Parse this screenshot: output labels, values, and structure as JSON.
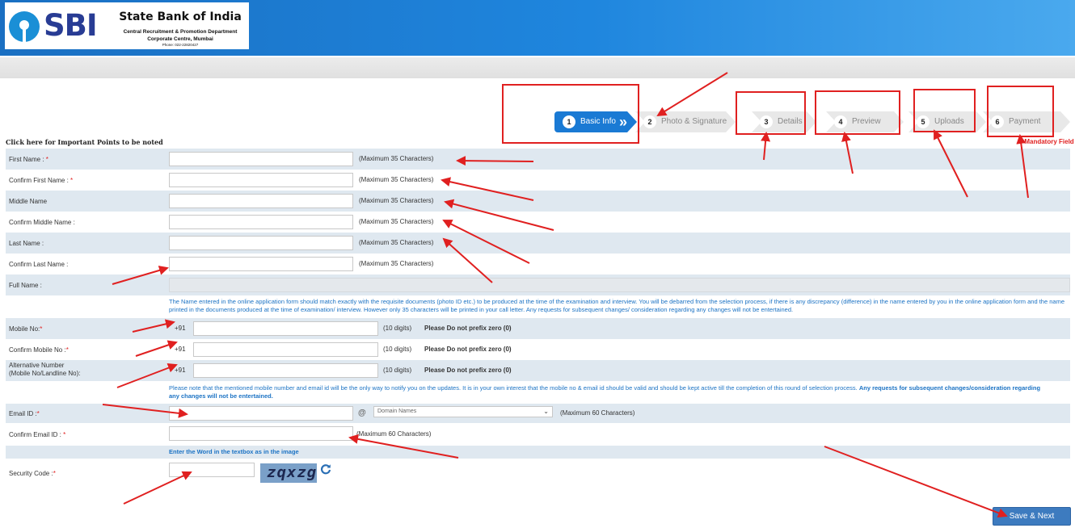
{
  "header": {
    "logo_text": "SBI",
    "bank_name": "State Bank of India",
    "subtitle1": "Central Recruitment & Promotion Department",
    "subtitle2": "Corporate Centre, Mumbai",
    "subtitle3": "Phone: 022-22820427",
    "brand_color": "#1f86de"
  },
  "steps": [
    {
      "num": "1",
      "label": "Basic Info",
      "active": true
    },
    {
      "num": "2",
      "label": "Photo & Signature"
    },
    {
      "num": "3",
      "label": "Details"
    },
    {
      "num": "4",
      "label": "Preview"
    },
    {
      "num": "5",
      "label": "Uploads"
    },
    {
      "num": "6",
      "label": "Payment"
    }
  ],
  "important_link": "Click here for Important Points to be noted",
  "mandatory_note": "* Mandatory Field",
  "form": {
    "first_name": {
      "label": "First Name :",
      "hint": "(Maximum 35 Characters)"
    },
    "confirm_first_name": {
      "label": "Confirm First Name :",
      "hint": "(Maximum 35 Characters)"
    },
    "middle_name": {
      "label": "Middle Name",
      "hint": "(Maximum 35 Characters)"
    },
    "confirm_middle_name": {
      "label": "Confirm Middle Name :",
      "hint": "(Maximum 35 Characters)"
    },
    "last_name": {
      "label": "Last Name :",
      "hint": "(Maximum 35 Characters)"
    },
    "confirm_last_name": {
      "label": "Confirm Last Name :",
      "hint": "(Maximum 35 Characters)"
    },
    "full_name": {
      "label": "Full Name :"
    },
    "name_note": "The Name entered in the online application form should match exactly with the requisite documents (photo ID etc.) to be produced at the time of the examination and interview. You will be debarred from the selection process, if there is any discrepancy (difference) in the name entered by you in the online application form and the name printed in the documents produced at the time of examination/ interview. However only 35 characters will be printed in your call letter. Any requests for subsequent changes/ consideration regarding any changes will not be entertained.",
    "mobile": {
      "label": "Mobile No:",
      "prefix": "+91",
      "digits": "(10 digits)",
      "warn": "Please Do not prefix zero (0)"
    },
    "confirm_mobile": {
      "label": "Confirm Mobile No :",
      "prefix": "+91",
      "digits": "(10 digits)",
      "warn": "Please Do not prefix zero (0)"
    },
    "alt_number": {
      "label1": "Alternative Number",
      "label2": "(Mobile No/Landline No):",
      "prefix": "+91",
      "digits": "(10 digits)",
      "warn": "Please Do not prefix zero (0)"
    },
    "contact_note": "Please note that the mentioned mobile number and email id will be the only way to notify you on the updates. It is in your own interest that the mobile no & email id should be valid and should be kept active till the completion of this round of selection process.",
    "contact_note_bold": "Any requests for subsequent changes/consideration regarding any changes will not be entertained.",
    "email": {
      "label": "Email ID :",
      "at": "@",
      "domain_placeholder": "Domain Names",
      "hint": "(Maximum 60 Characters)"
    },
    "confirm_email": {
      "label": "Confirm Email ID :",
      "hint": "(Maximum 60 Characters)"
    },
    "captcha_instruction": "Enter the Word in the textbox as in the image",
    "security_code": {
      "label": "Security Code :",
      "captcha_text": "zqxzg"
    },
    "save_button": "Save & Next"
  },
  "annotation_color": "#e02020"
}
